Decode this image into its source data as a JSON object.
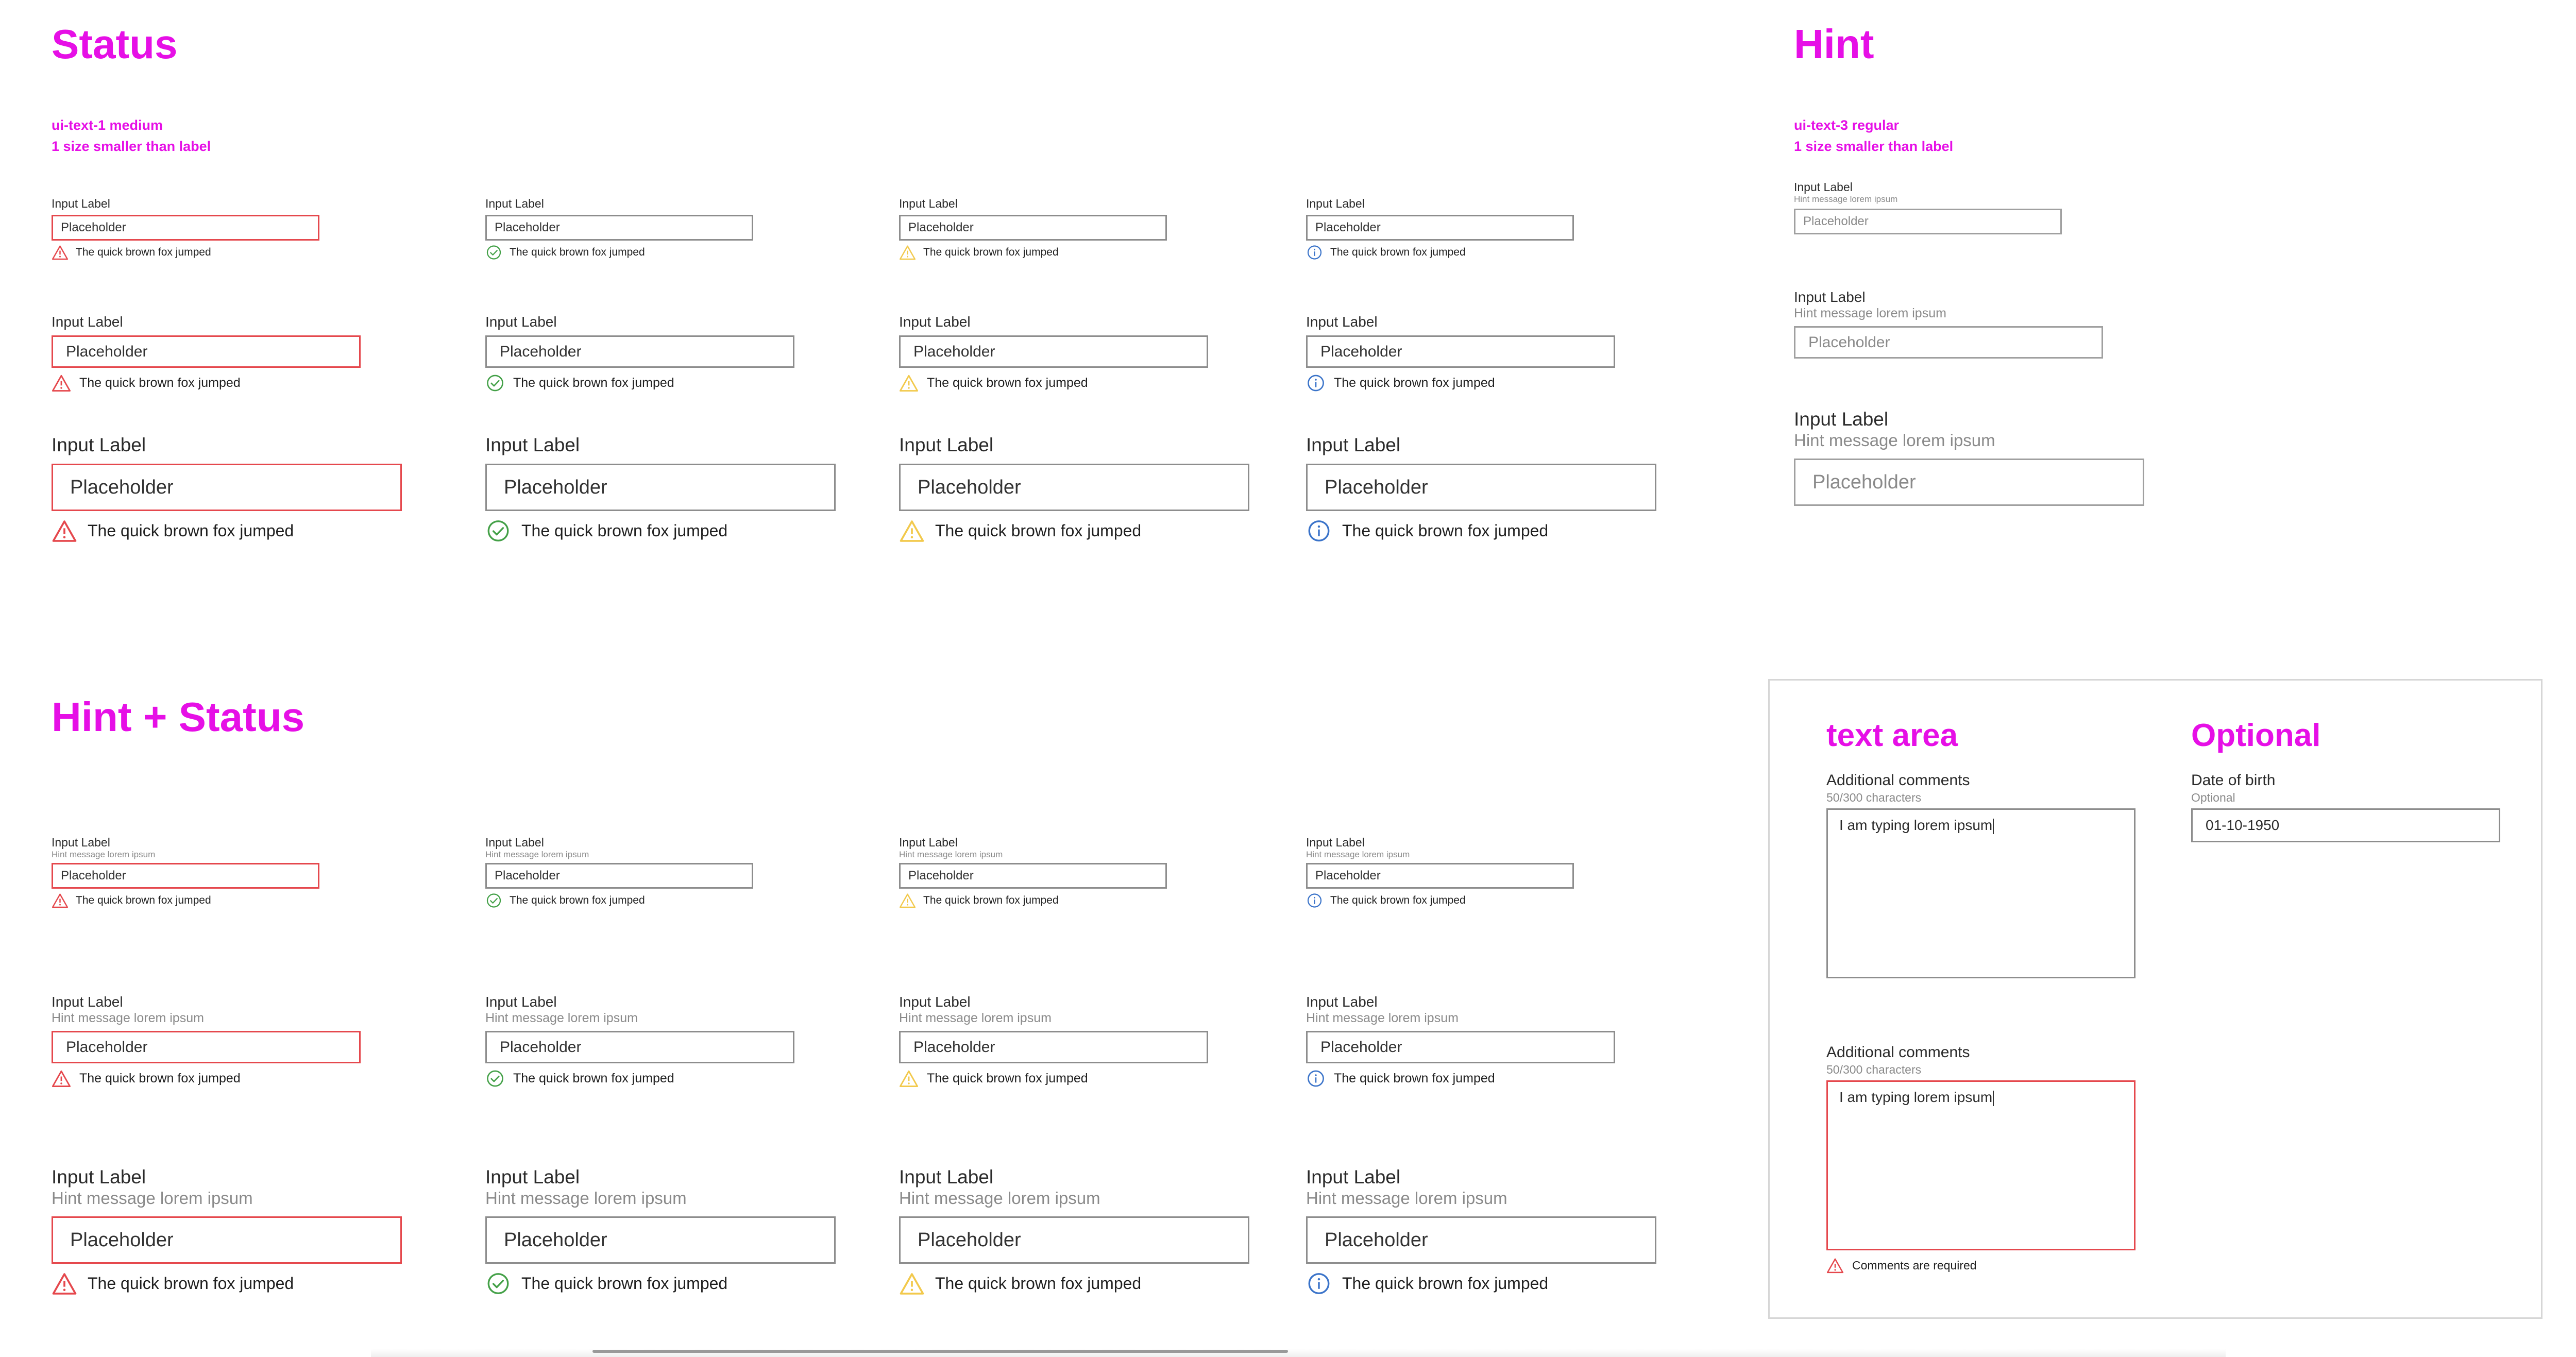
{
  "colors": {
    "heading": "#e60fe6",
    "error": "#e5484d",
    "success": "#43a047",
    "warning": "#f2c94c",
    "info": "#3a73c9",
    "border": "#8d8d8d"
  },
  "status": {
    "title": "Status",
    "note_line1": "ui-text-1 medium",
    "note_line2": "1 size smaller than label"
  },
  "hint": {
    "title": "Hint",
    "note_line1": "ui-text-3 regular",
    "note_line2": "1 size smaller than label"
  },
  "hint_status": {
    "title": "Hint + Status"
  },
  "field": {
    "label": "Input Label",
    "placeholder": "Placeholder",
    "hint": "Hint message lorem ipsum",
    "message": "The quick brown fox jumped"
  },
  "status_icons": [
    "error-icon",
    "success-icon",
    "warning-icon",
    "info-icon"
  ],
  "text_area": {
    "title": "text area",
    "label": "Additional comments",
    "count": "50/300 characters",
    "value": "I am typing lorem ipsum",
    "error_message": "Comments are required"
  },
  "optional": {
    "title": "Optional",
    "label": "Date of birth",
    "hint": "Optional",
    "value": "01-10-1950"
  }
}
